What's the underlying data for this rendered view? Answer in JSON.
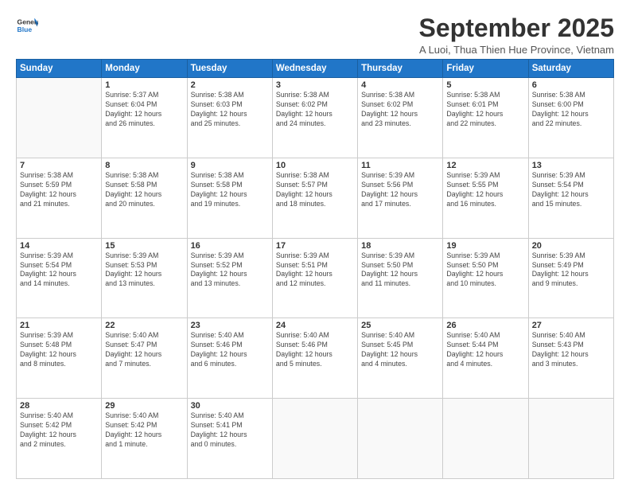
{
  "header": {
    "logo_line1": "General",
    "logo_line2": "Blue",
    "month": "September 2025",
    "location": "A Luoi, Thua Thien Hue Province, Vietnam"
  },
  "weekdays": [
    "Sunday",
    "Monday",
    "Tuesday",
    "Wednesday",
    "Thursday",
    "Friday",
    "Saturday"
  ],
  "weeks": [
    [
      {
        "day": "",
        "info": ""
      },
      {
        "day": "1",
        "info": "Sunrise: 5:37 AM\nSunset: 6:04 PM\nDaylight: 12 hours\nand 26 minutes."
      },
      {
        "day": "2",
        "info": "Sunrise: 5:38 AM\nSunset: 6:03 PM\nDaylight: 12 hours\nand 25 minutes."
      },
      {
        "day": "3",
        "info": "Sunrise: 5:38 AM\nSunset: 6:02 PM\nDaylight: 12 hours\nand 24 minutes."
      },
      {
        "day": "4",
        "info": "Sunrise: 5:38 AM\nSunset: 6:02 PM\nDaylight: 12 hours\nand 23 minutes."
      },
      {
        "day": "5",
        "info": "Sunrise: 5:38 AM\nSunset: 6:01 PM\nDaylight: 12 hours\nand 22 minutes."
      },
      {
        "day": "6",
        "info": "Sunrise: 5:38 AM\nSunset: 6:00 PM\nDaylight: 12 hours\nand 22 minutes."
      }
    ],
    [
      {
        "day": "7",
        "info": "Sunrise: 5:38 AM\nSunset: 5:59 PM\nDaylight: 12 hours\nand 21 minutes."
      },
      {
        "day": "8",
        "info": "Sunrise: 5:38 AM\nSunset: 5:58 PM\nDaylight: 12 hours\nand 20 minutes."
      },
      {
        "day": "9",
        "info": "Sunrise: 5:38 AM\nSunset: 5:58 PM\nDaylight: 12 hours\nand 19 minutes."
      },
      {
        "day": "10",
        "info": "Sunrise: 5:38 AM\nSunset: 5:57 PM\nDaylight: 12 hours\nand 18 minutes."
      },
      {
        "day": "11",
        "info": "Sunrise: 5:39 AM\nSunset: 5:56 PM\nDaylight: 12 hours\nand 17 minutes."
      },
      {
        "day": "12",
        "info": "Sunrise: 5:39 AM\nSunset: 5:55 PM\nDaylight: 12 hours\nand 16 minutes."
      },
      {
        "day": "13",
        "info": "Sunrise: 5:39 AM\nSunset: 5:54 PM\nDaylight: 12 hours\nand 15 minutes."
      }
    ],
    [
      {
        "day": "14",
        "info": "Sunrise: 5:39 AM\nSunset: 5:54 PM\nDaylight: 12 hours\nand 14 minutes."
      },
      {
        "day": "15",
        "info": "Sunrise: 5:39 AM\nSunset: 5:53 PM\nDaylight: 12 hours\nand 13 minutes."
      },
      {
        "day": "16",
        "info": "Sunrise: 5:39 AM\nSunset: 5:52 PM\nDaylight: 12 hours\nand 13 minutes."
      },
      {
        "day": "17",
        "info": "Sunrise: 5:39 AM\nSunset: 5:51 PM\nDaylight: 12 hours\nand 12 minutes."
      },
      {
        "day": "18",
        "info": "Sunrise: 5:39 AM\nSunset: 5:50 PM\nDaylight: 12 hours\nand 11 minutes."
      },
      {
        "day": "19",
        "info": "Sunrise: 5:39 AM\nSunset: 5:50 PM\nDaylight: 12 hours\nand 10 minutes."
      },
      {
        "day": "20",
        "info": "Sunrise: 5:39 AM\nSunset: 5:49 PM\nDaylight: 12 hours\nand 9 minutes."
      }
    ],
    [
      {
        "day": "21",
        "info": "Sunrise: 5:39 AM\nSunset: 5:48 PM\nDaylight: 12 hours\nand 8 minutes."
      },
      {
        "day": "22",
        "info": "Sunrise: 5:40 AM\nSunset: 5:47 PM\nDaylight: 12 hours\nand 7 minutes."
      },
      {
        "day": "23",
        "info": "Sunrise: 5:40 AM\nSunset: 5:46 PM\nDaylight: 12 hours\nand 6 minutes."
      },
      {
        "day": "24",
        "info": "Sunrise: 5:40 AM\nSunset: 5:46 PM\nDaylight: 12 hours\nand 5 minutes."
      },
      {
        "day": "25",
        "info": "Sunrise: 5:40 AM\nSunset: 5:45 PM\nDaylight: 12 hours\nand 4 minutes."
      },
      {
        "day": "26",
        "info": "Sunrise: 5:40 AM\nSunset: 5:44 PM\nDaylight: 12 hours\nand 4 minutes."
      },
      {
        "day": "27",
        "info": "Sunrise: 5:40 AM\nSunset: 5:43 PM\nDaylight: 12 hours\nand 3 minutes."
      }
    ],
    [
      {
        "day": "28",
        "info": "Sunrise: 5:40 AM\nSunset: 5:42 PM\nDaylight: 12 hours\nand 2 minutes."
      },
      {
        "day": "29",
        "info": "Sunrise: 5:40 AM\nSunset: 5:42 PM\nDaylight: 12 hours\nand 1 minute."
      },
      {
        "day": "30",
        "info": "Sunrise: 5:40 AM\nSunset: 5:41 PM\nDaylight: 12 hours\nand 0 minutes."
      },
      {
        "day": "",
        "info": ""
      },
      {
        "day": "",
        "info": ""
      },
      {
        "day": "",
        "info": ""
      },
      {
        "day": "",
        "info": ""
      }
    ]
  ]
}
